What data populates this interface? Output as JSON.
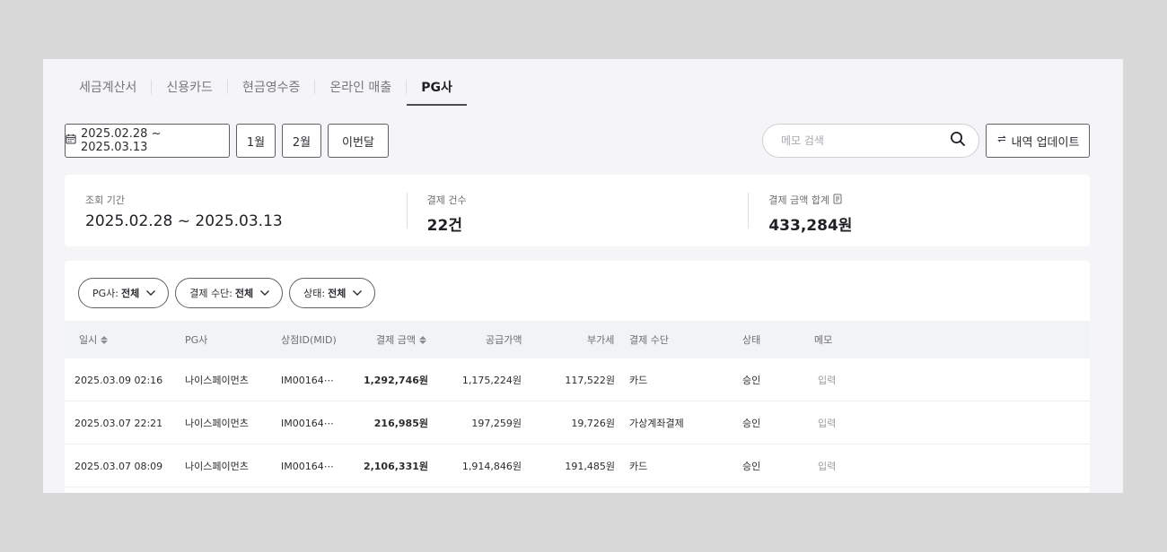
{
  "tabs": [
    {
      "label": "세금계산서"
    },
    {
      "label": "신용카드"
    },
    {
      "label": "현금영수증"
    },
    {
      "label": "온라인 매출"
    },
    {
      "label": "PG사"
    }
  ],
  "active_tab": "PG사",
  "toolbar": {
    "date_range": "2025.02.28 ~ 2025.03.13",
    "month1": "1월",
    "month2": "2월",
    "this_month": "이번달",
    "search_placeholder": "메모 검색",
    "update_label": "내역 업데이트"
  },
  "summary": {
    "period_label": "조회 기간",
    "period_value": "2025.02.28 ~ 2025.03.13",
    "count_label": "결제 건수",
    "count_value": "22건",
    "total_label": "결제 금액 합계",
    "total_value": "433,284원"
  },
  "filters": [
    {
      "label": "PG사: ",
      "value": "전체"
    },
    {
      "label": "결제 수단: ",
      "value": "전체"
    },
    {
      "label": "상태: ",
      "value": "전체"
    }
  ],
  "table": {
    "headers": {
      "datetime": "일시",
      "pg": "PG사",
      "mid": "상점ID(MID)",
      "amount": "결제 금액",
      "supply": "공급가액",
      "vat": "부가세",
      "method": "결제 수단",
      "status": "상태",
      "memo": "메모"
    },
    "rows": [
      {
        "datetime": "2025.03.09 02:16",
        "pg": "나이스페이먼츠",
        "mid": "IM00164⋯",
        "amount": "1,292,746원",
        "supply": "1,175,224원",
        "vat": "117,522원",
        "method": "카드",
        "status": "승인",
        "memo": "입력"
      },
      {
        "datetime": "2025.03.07 22:21",
        "pg": "나이스페이먼츠",
        "mid": "IM00164⋯",
        "amount": "216,985원",
        "supply": "197,259원",
        "vat": "19,726원",
        "method": "가상계좌결제",
        "status": "승인",
        "memo": "입력"
      },
      {
        "datetime": "2025.03.07 08:09",
        "pg": "나이스페이먼츠",
        "mid": "IM00164⋯",
        "amount": "2,106,331원",
        "supply": "1,914,846원",
        "vat": "191,485원",
        "method": "카드",
        "status": "승인",
        "memo": "입력"
      }
    ]
  },
  "colors": {
    "page_background": "#d8d8d8",
    "panel_background": "#f5f5f7",
    "header_background": "#f2f3f6",
    "border": "#5c5e64"
  }
}
